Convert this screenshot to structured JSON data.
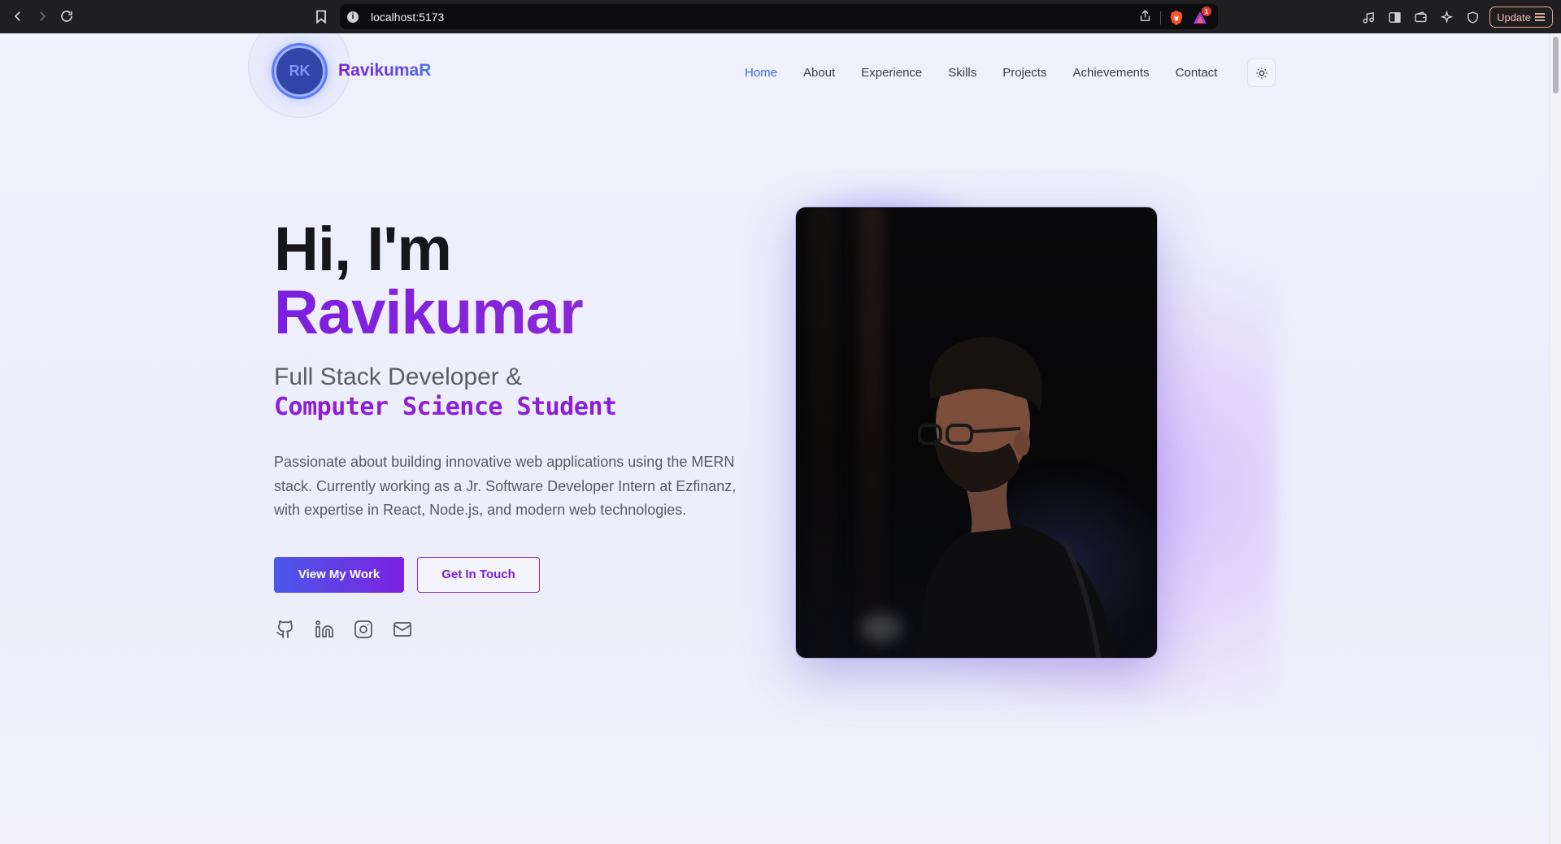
{
  "browser": {
    "url": "localhost:5173",
    "update_label": "Update",
    "rewards_badge": "1"
  },
  "header": {
    "logo_initials": "RK",
    "brand": "RavikumaR",
    "nav": [
      "Home",
      "About",
      "Experience",
      "Skills",
      "Projects",
      "Achievements",
      "Contact"
    ],
    "active_nav": "Home"
  },
  "hero": {
    "greeting": "Hi, I'm",
    "name": "Ravikumar",
    "role_line1": "Full Stack Developer &",
    "role_line2": "Computer Science Student",
    "description": "Passionate about building innovative web applications using the MERN stack. Currently working as a Jr. Software Developer Intern at Ezfinanz, with expertise in React, Node.js, and modern web technologies.",
    "primary_button": "View My Work",
    "secondary_button": "Get In Touch",
    "socials": [
      "github-icon",
      "linkedin-icon",
      "instagram-icon",
      "mail-icon"
    ]
  },
  "colors": {
    "accent_purple": "#7b1fe0",
    "accent_blue": "#4b58ea",
    "nav_active": "#3a6ad6"
  }
}
